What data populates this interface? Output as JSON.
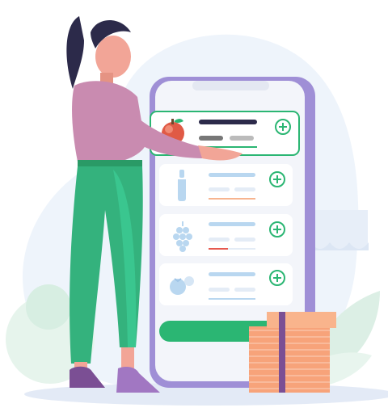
{
  "illustration": {
    "subject": "woman-selecting-grocery-item-on-phone",
    "colors": {
      "background_blob": "#EEF4FB",
      "phone_frame": "#9F8FD6",
      "phone_screen": "#F3F5FA",
      "card": "#FFFFFF",
      "accent_green": "#2BB673",
      "pants_green": "#34B27D",
      "shirt_pink": "#C98BB0",
      "skin": "#F2A597",
      "hair": "#2C2A4A",
      "box_orange": "#F7A37A",
      "shoe_purple": "#7B4F94",
      "bar_blue": "#B9D7F0",
      "bar_orange": "#F7B48F",
      "bar_red": "#E6594F"
    },
    "products": [
      {
        "icon": "apple-icon",
        "selected": true
      },
      {
        "icon": "bottle-icon",
        "selected": false
      },
      {
        "icon": "grapes-icon",
        "selected": false
      },
      {
        "icon": "tomato-icon",
        "selected": false
      }
    ]
  }
}
